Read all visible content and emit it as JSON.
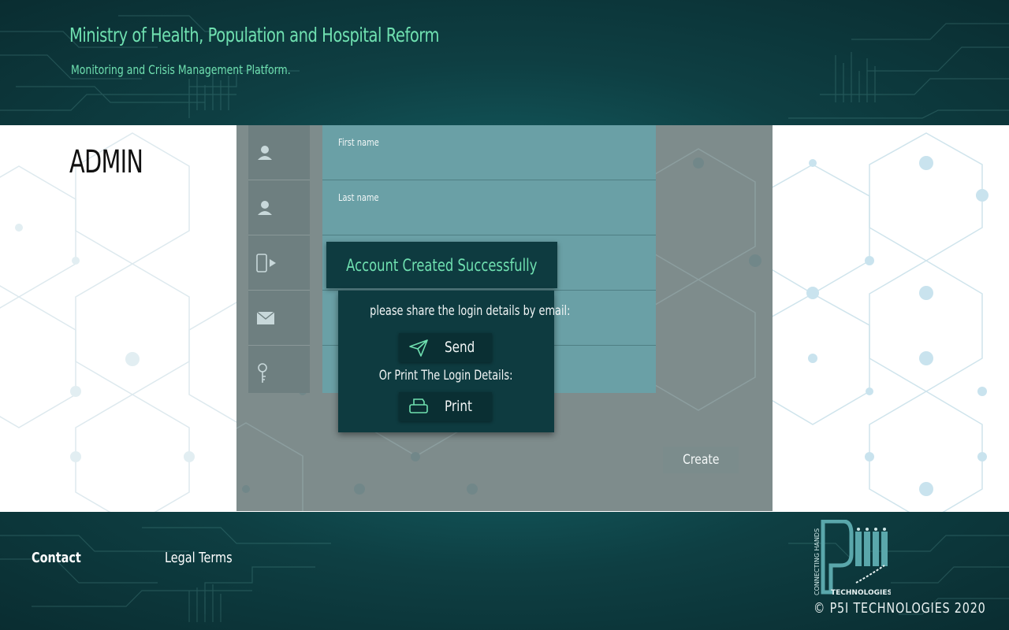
{
  "header": {
    "title": "Ministry of Health, Population and Hospital Reform",
    "subtitle": "Monitoring and Crisis Management Platform."
  },
  "sidebar": {
    "role_label": "ADMIN"
  },
  "form": {
    "fields": [
      {
        "icon": "user-icon",
        "label": "First name"
      },
      {
        "icon": "user-icon",
        "label": "Last name"
      },
      {
        "icon": "phone-icon",
        "label": ""
      },
      {
        "icon": "envelope-icon",
        "label": ""
      },
      {
        "icon": "key-icon",
        "label": ""
      }
    ],
    "create_label": "Create"
  },
  "modal": {
    "title": "Account Created Successfully",
    "email_prompt": "please share the login details by email:",
    "send_label": "Send",
    "send_icon": "paper-plane-icon",
    "print_prompt": "Or Print The Login Details:",
    "print_label": "Print",
    "print_icon": "printer-icon"
  },
  "footer": {
    "contact_label": "Contact",
    "legal_label": "Legal Terms",
    "logo_side_text": "CONNECTING HANDS",
    "logo_sub_text": "TECHNOLOGIES",
    "copyright": "© P5I TECHNOLOGIES 2020"
  },
  "colors": {
    "header_bg": "#0e3f43",
    "accent_green": "#6fe0b0",
    "modal_bg": "#0e3b40",
    "panel_overlay": "#7e8c8c",
    "field_bg": "#6aa0a6"
  }
}
